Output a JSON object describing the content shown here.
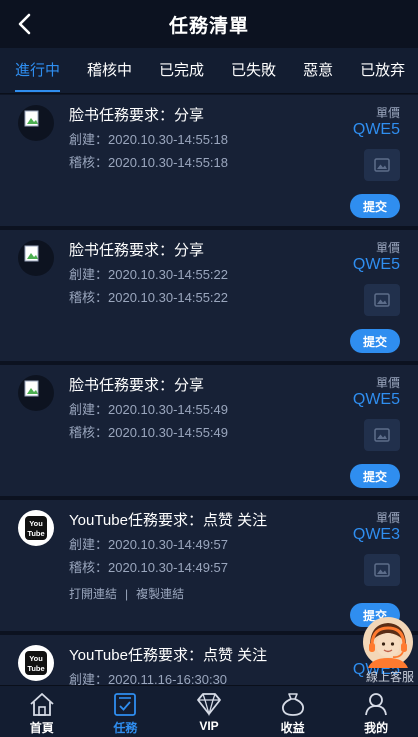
{
  "header": {
    "title": "任務清單"
  },
  "tabs": [
    {
      "label": "進行中"
    },
    {
      "label": "稽核中"
    },
    {
      "label": "已完成"
    },
    {
      "label": "已失敗"
    },
    {
      "label": "惡意"
    },
    {
      "label": "已放弃"
    }
  ],
  "tasks": [
    {
      "title": "脸书任務要求：分享",
      "created": "創建：2020.10.30-14:55:18",
      "reviewed": "稽核：2020.10.30-14:55:18",
      "price_label": "單價",
      "price": "QWE5",
      "submit_label": "提交",
      "icon": "broken-image-icon"
    },
    {
      "title": "脸书任務要求：分享",
      "created": "創建：2020.10.30-14:55:22",
      "reviewed": "稽核：2020.10.30-14:55:22",
      "price_label": "單價",
      "price": "QWE5",
      "submit_label": "提交",
      "icon": "broken-image-icon"
    },
    {
      "title": "脸书任務要求：分享",
      "created": "創建：2020.10.30-14:55:49",
      "reviewed": "稽核：2020.10.30-14:55:49",
      "price_label": "單價",
      "price": "QWE5",
      "submit_label": "提交",
      "icon": "broken-image-icon"
    },
    {
      "title": "YouTube任務要求：点赞 关注",
      "created": "創建：2020.10.30-14:49:57",
      "reviewed": "稽核：2020.10.30-14:49:57",
      "link_open": "打開連結",
      "link_sep": "|",
      "link_copy": "複製連結",
      "price_label": "單價",
      "price": "QWE3",
      "submit_label": "提交",
      "icon": "youtube-logo-icon",
      "logo_text": [
        "You",
        "Tube"
      ]
    },
    {
      "title": "YouTube任務要求：点赞 关注",
      "created": "創建：2020.11.16-16:30:30",
      "price_label": "單價",
      "price": "QWE5",
      "icon": "youtube-logo-icon",
      "logo_text": [
        "You",
        "Tube"
      ]
    }
  ],
  "customer_service": {
    "label": "線上客服",
    "icon": "customer-service-avatar-icon"
  },
  "tabbar": [
    {
      "label": "首頁",
      "icon": "home-icon"
    },
    {
      "label": "任務",
      "icon": "task-icon",
      "active": true
    },
    {
      "label": "VIP",
      "icon": "diamond-icon"
    },
    {
      "label": "收益",
      "icon": "money-bag-icon"
    },
    {
      "label": "我的",
      "icon": "user-icon"
    }
  ],
  "colors": {
    "accent": "#2f8ef0",
    "background": "#0f1626",
    "card": "#172136"
  }
}
